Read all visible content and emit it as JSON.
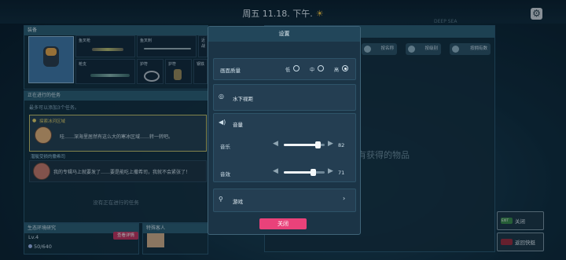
{
  "header": {
    "datetime": "周五 11.18. 下午.",
    "weather_icon": "sun-icon"
  },
  "equipment": {
    "title": "装备",
    "slots": [
      {
        "label": "鱼叉枪"
      },
      {
        "label": "鱼叉刺"
      },
      {
        "label": "近战"
      },
      {
        "label": "枪支"
      },
      {
        "label": "护符"
      },
      {
        "label": "护符"
      },
      {
        "label": "钢铁"
      }
    ]
  },
  "tasks": {
    "title": "正在进行的任务",
    "hint": "最多可以添加3个任务。",
    "active": {
      "title": "探索冰河区域",
      "body": "哇……深海里居然有这么大的寒冰区域……转一转吧。"
    },
    "secondary": {
      "title": "潜艇受损的撒希司",
      "body": "我的专辑马上就要发了……要是能吃上撒希司，我就不会紧张了！"
    },
    "empty": "没有正在进行的任务"
  },
  "eco": {
    "title": "生态环境研究",
    "level": "Lv.4",
    "progress": "50/640",
    "detail_button": "查看详情"
  },
  "guest": {
    "title": "特殊客人"
  },
  "right_panel": {
    "tabs": [
      "按名称",
      "按级别",
      "按拥有数"
    ],
    "empty_text": "有获得的物品",
    "watermark": "DEEP SEA"
  },
  "side_buttons": {
    "close": "关闭",
    "back": "返回快艇",
    "close_badge": "EXIT"
  },
  "settings": {
    "title": "设置",
    "quality_label": "画面质量",
    "quality_options": [
      "低",
      "中",
      "高"
    ],
    "quality_selected": "高",
    "underwater_label": "水下视距",
    "volume_header": "音量",
    "music_label": "音乐",
    "music_value": "82",
    "sfx_label": "音效",
    "sfx_value": "71",
    "game_label": "游戏",
    "close_button": "关闭"
  },
  "colors": {
    "accent": "#e9427a",
    "panel": "#1b3446",
    "quest_gold": "#e8d56a"
  }
}
